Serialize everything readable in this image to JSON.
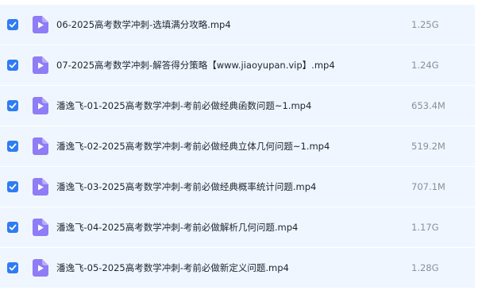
{
  "files": [
    {
      "name": "06-2025高考数学冲刺-选填满分攻略.mp4",
      "size": "1.25G",
      "checked": true,
      "icon": "video-file-icon"
    },
    {
      "name": "07-2025高考数学冲刺-解答得分策略【www.jiaoyupan.vip】.mp4",
      "size": "1.24G",
      "checked": true,
      "icon": "video-file-icon"
    },
    {
      "name": "潘逸飞-01-2025高考数学冲刺-考前必做经典函数问题~1.mp4",
      "size": "653.4M",
      "checked": true,
      "icon": "video-file-icon"
    },
    {
      "name": "潘逸飞-02-2025高考数学冲刺-考前必做经典立体几何问题~1.mp4",
      "size": "519.2M",
      "checked": true,
      "icon": "video-file-icon"
    },
    {
      "name": "潘逸飞-03-2025高考数学冲刺-考前必做经典概率统计问题.mp4",
      "size": "707.1M",
      "checked": true,
      "icon": "video-file-icon"
    },
    {
      "name": "潘逸飞-04-2025高考数学冲刺-考前必做解析几何问题.mp4",
      "size": "1.17G",
      "checked": true,
      "icon": "video-file-icon"
    },
    {
      "name": "潘逸飞-05-2025高考数学冲刺-考前必做新定义问题.mp4",
      "size": "1.28G",
      "checked": true,
      "icon": "video-file-icon"
    }
  ],
  "colors": {
    "row_background": "#f0f6ff",
    "checkbox": "#2f7cf6",
    "video_icon": "#8f7cf7",
    "name_text": "#1f2430",
    "size_text": "#8a8f99"
  }
}
